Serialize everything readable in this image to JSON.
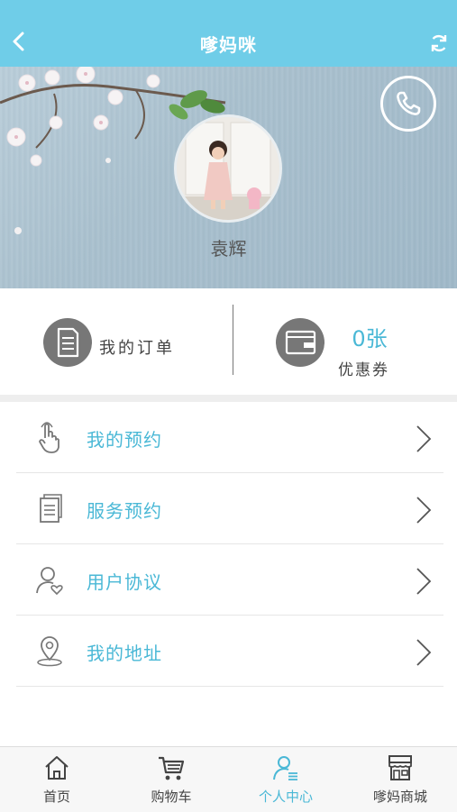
{
  "header": {
    "title": "嗲妈咪"
  },
  "profile": {
    "username": "袁辉"
  },
  "stats": {
    "orders_label": "我的订单",
    "coupon_count": "0张",
    "coupon_label": "优惠券"
  },
  "menu": {
    "items": [
      {
        "label": "我的预约",
        "icon": "touch-hand-icon"
      },
      {
        "label": "服务预约",
        "icon": "document-icon"
      },
      {
        "label": "用户协议",
        "icon": "user-heart-icon"
      },
      {
        "label": "我的地址",
        "icon": "location-pin-icon"
      }
    ]
  },
  "tabbar": {
    "items": [
      {
        "label": "首页",
        "icon": "home-icon"
      },
      {
        "label": "购物车",
        "icon": "cart-icon"
      },
      {
        "label": "个人中心",
        "icon": "user-icon",
        "active": true
      },
      {
        "label": "嗲妈商城",
        "icon": "store-icon"
      }
    ]
  },
  "colors": {
    "accent": "#6fcde8",
    "link": "#4ab8d6",
    "icon_gray": "#777777"
  }
}
